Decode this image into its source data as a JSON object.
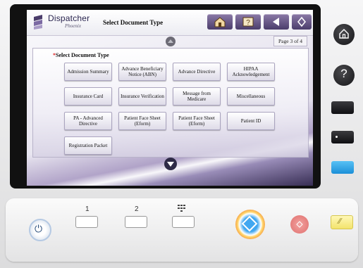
{
  "header": {
    "logo_name": "Dispatcher",
    "logo_sub": "Phoenix",
    "title": "Select Document Type",
    "page_indicator": "Page 3 of 4",
    "buttons": [
      {
        "name": "home-icon"
      },
      {
        "name": "help-icon"
      },
      {
        "name": "back-icon"
      },
      {
        "name": "start-icon"
      }
    ]
  },
  "panel": {
    "required_mark": "*",
    "label": "Select Document Type",
    "documents": [
      "Admission Summary",
      "Advance Beneficiary Notice (ABN)",
      "Advance Directive",
      "HIPAA Acknowledgement",
      "Insurance Card",
      "Insurance Verification",
      "Message from Medicare",
      "Miscellaneous",
      "PA - Advanced Directive",
      "Patient Face Sheet (Eform)",
      "Patient Face Sheet (Eform)",
      "Patient ID",
      "Registration Packet"
    ]
  },
  "device": {
    "side_buttons": [
      "home-icon",
      "help-icon",
      "menu-key",
      "mode-key",
      "access-key"
    ],
    "help_glyph": "?",
    "keypad_labels": [
      "1",
      "2"
    ],
    "colors": {
      "accent": "#4b3d6b",
      "access_key": "#1b8fd8",
      "stop": "#e06f6d",
      "reset": "#f3e36c"
    }
  }
}
